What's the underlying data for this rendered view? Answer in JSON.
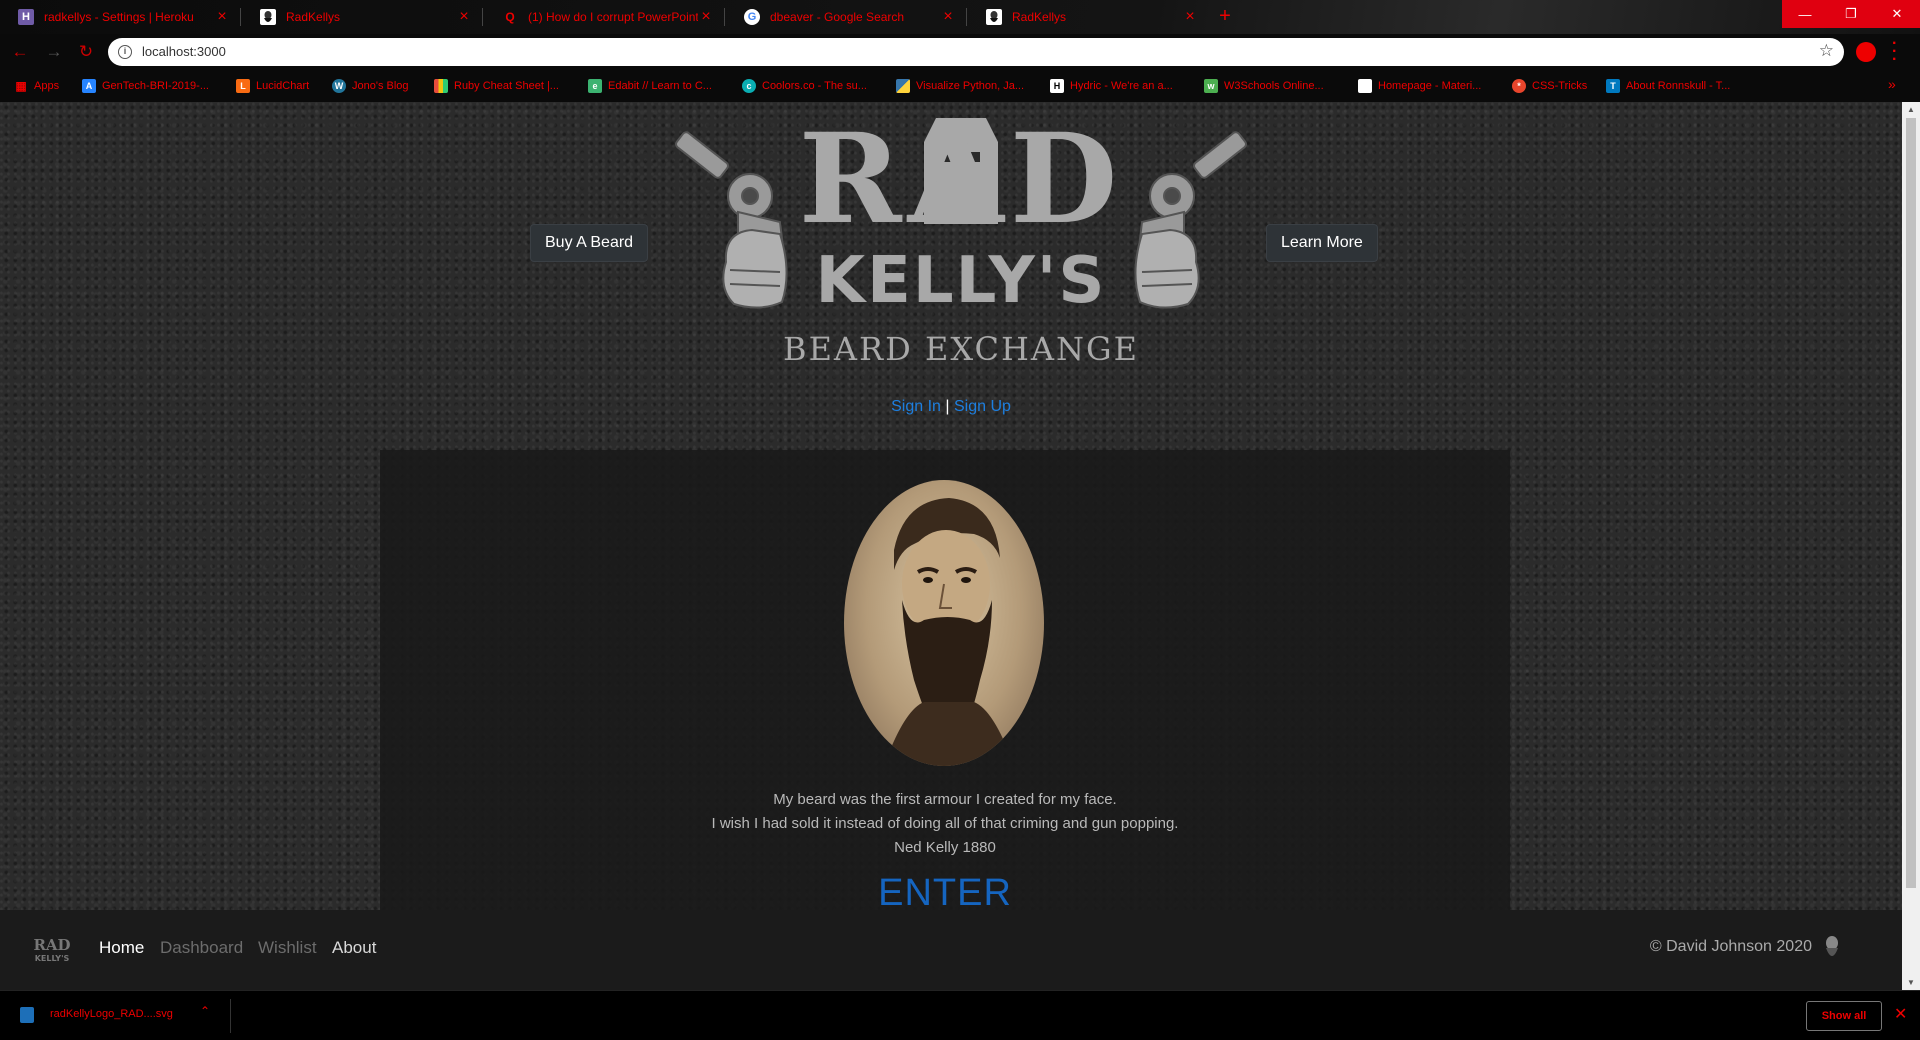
{
  "browser": {
    "tabs": [
      {
        "title": "radkellys - Settings | Heroku",
        "favicon": "heroku-icon",
        "favcolor": "#6f5ba7",
        "favtext": "H"
      },
      {
        "title": "RadKellys",
        "favicon": "radkellys-icon",
        "favcolor": "#ffffff",
        "favtext": ""
      },
      {
        "title": "(1) How do I corrupt PowerPoint",
        "favicon": "quora-icon",
        "favcolor": "#000000",
        "favtext": "Q"
      },
      {
        "title": "dbeaver - Google Search",
        "favicon": "google-icon",
        "favcolor": "#ffffff",
        "favtext": "G"
      },
      {
        "title": "RadKellys",
        "favicon": "radkellys-icon",
        "favcolor": "#ffffff",
        "favtext": ""
      }
    ],
    "new_tab": "+",
    "url": "localhost:3000",
    "bookmarks": [
      {
        "label": "Apps",
        "icon": "apps-icon",
        "color": "#e00"
      },
      {
        "label": "GenTech-BRI-2019-...",
        "icon": "atlassian-icon",
        "color": "#2684ff"
      },
      {
        "label": "LucidChart",
        "icon": "lucidchart-icon",
        "color": "#f96b13"
      },
      {
        "label": "Jono's Blog",
        "icon": "wordpress-icon",
        "color": "#21759b"
      },
      {
        "label": "Ruby Cheat Sheet |...",
        "icon": "bookmark-icon",
        "color": "#8e44ad"
      },
      {
        "label": "Edabit // Learn to C...",
        "icon": "edabit-icon",
        "color": "#3cb371"
      },
      {
        "label": "Coolors.co - The su...",
        "icon": "coolors-icon",
        "color": "#0aaeb3"
      },
      {
        "label": "Visualize Python, Ja...",
        "icon": "python-icon",
        "color": "#3776ab"
      },
      {
        "label": "Hydric - We're an a...",
        "icon": "hydric-icon",
        "color": "#ffffff"
      },
      {
        "label": "W3Schools Online...",
        "icon": "w3schools-icon",
        "color": "#4caf50"
      },
      {
        "label": "Homepage - Materi...",
        "icon": "material-icon",
        "color": "#ffffff"
      },
      {
        "label": "CSS-Tricks",
        "icon": "csstricks-icon",
        "color": "#e8452c"
      },
      {
        "label": "About Ronnskull - T...",
        "icon": "trello-icon",
        "color": "#0079bf"
      }
    ]
  },
  "header": {
    "buy_button": "Buy A Beard",
    "learn_button": "Learn More",
    "logo": {
      "line1": "RAD",
      "line2": "KELLY'S",
      "line3": "BEARD EXCHANGE"
    },
    "sign_in": "Sign In",
    "separator": "|",
    "sign_up": "Sign Up"
  },
  "hero": {
    "quote_line1": "My beard was the first armour I created for my face.",
    "quote_line2": "I wish I had sold it instead of doing all of that criming and gun popping.",
    "attribution": "Ned Kelly 1880",
    "enter": "ENTER"
  },
  "footer": {
    "nav": [
      {
        "label": "Home",
        "color": "#ffffff"
      },
      {
        "label": "Dashboard",
        "color": "#6c6c6c"
      },
      {
        "label": "Wishlist",
        "color": "#6c6c6c"
      },
      {
        "label": "About",
        "color": "#d9d9d9"
      }
    ],
    "copyright": "© David Johnson 2020"
  },
  "downloads": {
    "filename": "radKellyLogo_RAD....svg",
    "show_all": "Show all"
  },
  "colors": {
    "accent": "#e00010",
    "link": "#1d7fe0",
    "enter": "#1565c0"
  }
}
